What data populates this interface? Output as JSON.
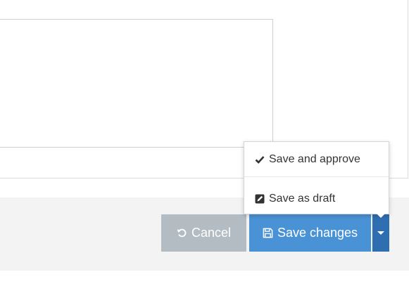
{
  "actions": {
    "cancel_label": "Cancel",
    "save_label": "Save changes"
  },
  "save_menu": {
    "items": [
      {
        "label": "Save and approve",
        "icon": "checkmark-icon"
      },
      {
        "label": "Save as draft",
        "icon": "pencil-square-icon"
      }
    ]
  },
  "icons": {
    "cancel": "undo-icon",
    "save": "floppy-disk-icon",
    "toggle": "caret-down-icon"
  },
  "colors": {
    "cancel_button": "#b2bcc2",
    "save_button": "#4a92d6",
    "save_toggle": "#2f6eb0",
    "footer_background": "#f3f3f3"
  }
}
